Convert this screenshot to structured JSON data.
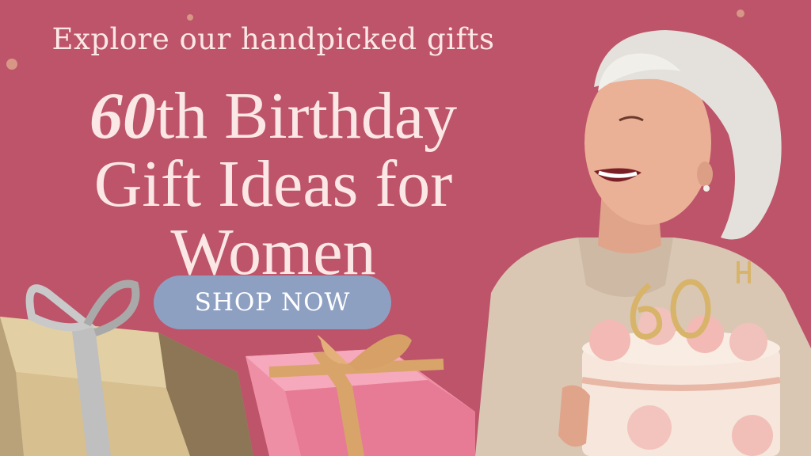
{
  "banner": {
    "tagline": "Explore our handpicked gifts",
    "headline_number": "60",
    "headline_line1_rest": "th Birthday",
    "headline_line2": "Gift Ideas for",
    "headline_line3": "Women",
    "cta_label": "SHOP NOW",
    "colors": {
      "background": "#bd5469",
      "text": "#fbe8e6",
      "button": "#8ea0c2"
    }
  }
}
